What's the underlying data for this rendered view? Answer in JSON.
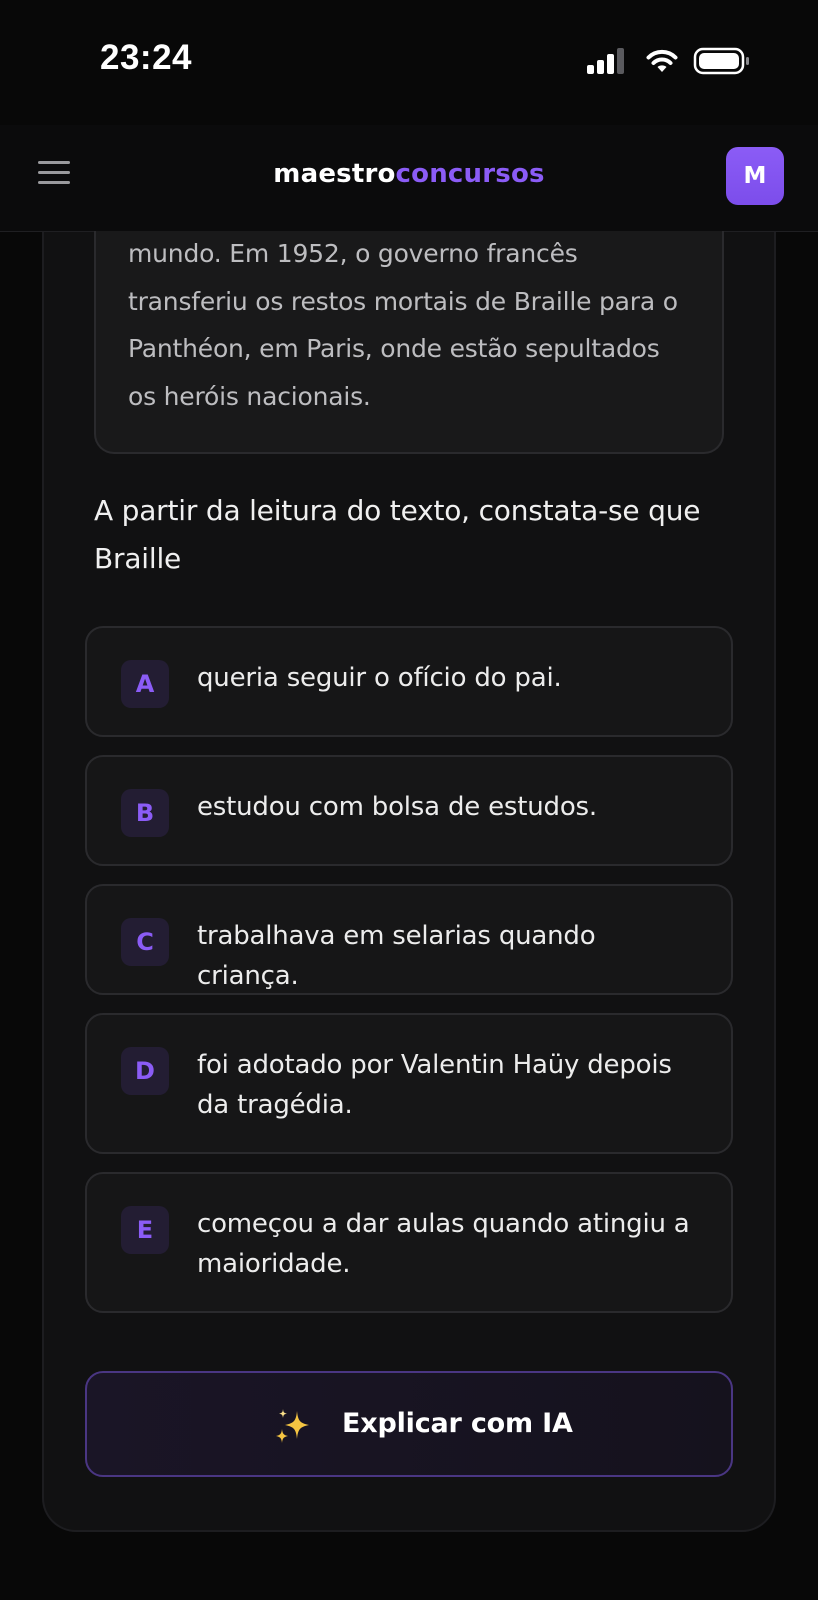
{
  "status_bar": {
    "time": "23:24"
  },
  "header": {
    "brand_part1": "maestro",
    "brand_part2": "concursos",
    "avatar_initial": "M",
    "brand_color": "#8b5cf6"
  },
  "passage": {
    "lines": [
      "mundo. Em 1952, o governo francês",
      "transferiu os restos mortais de Braille para o",
      "Panthéon, em Paris, onde estão sepultados",
      "os heróis nacionais."
    ]
  },
  "question": {
    "lines": [
      "A partir da leitura do texto, constata-se que",
      "Braille"
    ]
  },
  "options": [
    {
      "letter": "A",
      "text": "queria seguir o ofício do pai."
    },
    {
      "letter": "B",
      "text": "estudou com bolsa de estudos."
    },
    {
      "letter": "C",
      "text": "trabalhava em selarias quando criança."
    },
    {
      "letter": "D",
      "text": "foi adotado por Valentin Haüy depois da tragédia."
    },
    {
      "letter": "E",
      "text": "começou a dar aulas quando atingiu a maioridade."
    }
  ],
  "ai_button": {
    "label": "Explicar com IA",
    "icon": "sparkles-icon"
  },
  "icons": {
    "menu": "hamburger-menu-icon",
    "signal": "cellular-signal-icon",
    "wifi": "wifi-icon",
    "battery": "battery-icon"
  }
}
